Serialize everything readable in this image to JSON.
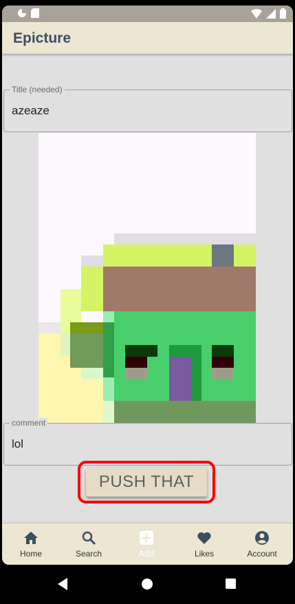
{
  "app": {
    "title": "Epicture"
  },
  "form": {
    "title_field": {
      "label": "Title (needed)",
      "value": "azeaze"
    },
    "comment_field": {
      "label": "comment",
      "value": "lol"
    },
    "submit_label": "PUSH THAT"
  },
  "bottom_nav": {
    "items": [
      {
        "label": "Home",
        "icon": "home-icon"
      },
      {
        "label": "Search",
        "icon": "search-icon"
      },
      {
        "label": "Add",
        "icon": "add-icon",
        "active": true
      },
      {
        "label": "Likes",
        "icon": "heart-icon"
      },
      {
        "label": "Account",
        "icon": "account-icon"
      }
    ]
  },
  "colors": {
    "appbar": "#ece6d2",
    "title_text": "#3a4f63",
    "highlight": "#ff0000",
    "button_bg": "#e6dcc6"
  }
}
